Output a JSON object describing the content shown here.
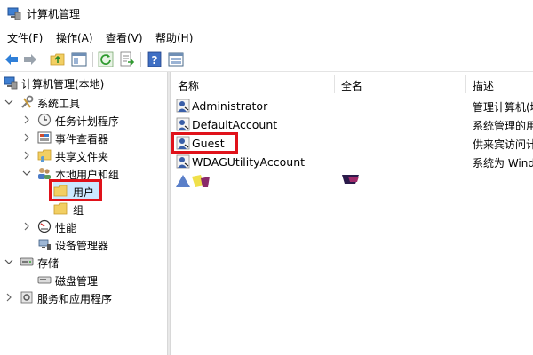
{
  "window": {
    "title": "计算机管理"
  },
  "menu": [
    {
      "label": "文件(F)"
    },
    {
      "label": "操作(A)"
    },
    {
      "label": "查看(V)"
    },
    {
      "label": "帮助(H)"
    }
  ],
  "toolbar": {
    "icons": [
      "back-arrow-icon",
      "forward-arrow-icon",
      "up-folder-icon",
      "show-hide-tree-icon",
      "refresh-icon",
      "export-list-icon",
      "help-icon",
      "properties-icon"
    ]
  },
  "tree": {
    "items": [
      {
        "label": "计算机管理(本地)"
      },
      {
        "label": "系统工具"
      },
      {
        "label": "任务计划程序"
      },
      {
        "label": "事件查看器"
      },
      {
        "label": "共享文件夹"
      },
      {
        "label": "本地用户和组"
      },
      {
        "label": "用户"
      },
      {
        "label": "组"
      },
      {
        "label": "性能"
      },
      {
        "label": "设备管理器"
      },
      {
        "label": "存储"
      },
      {
        "label": "磁盘管理"
      },
      {
        "label": "服务和应用程序"
      }
    ],
    "selected": "用户"
  },
  "list": {
    "columns": [
      {
        "label": "名称"
      },
      {
        "label": "全名"
      },
      {
        "label": "描述"
      }
    ],
    "rows": [
      {
        "name": "Administrator",
        "fullname": "",
        "description": "管理计算机(域"
      },
      {
        "name": "DefaultAccount",
        "fullname": "",
        "description": "系统管理的用户"
      },
      {
        "name": "Guest",
        "fullname": "",
        "description": "供来宾访问计"
      },
      {
        "name": "WDAGUtilityAccount",
        "fullname": "",
        "description": "系统为 Windo"
      }
    ],
    "highlighted": "Guest"
  },
  "colors": {
    "highlight": "#e0121a",
    "folder": "#f2cf63",
    "selection": "#cce8ff"
  }
}
